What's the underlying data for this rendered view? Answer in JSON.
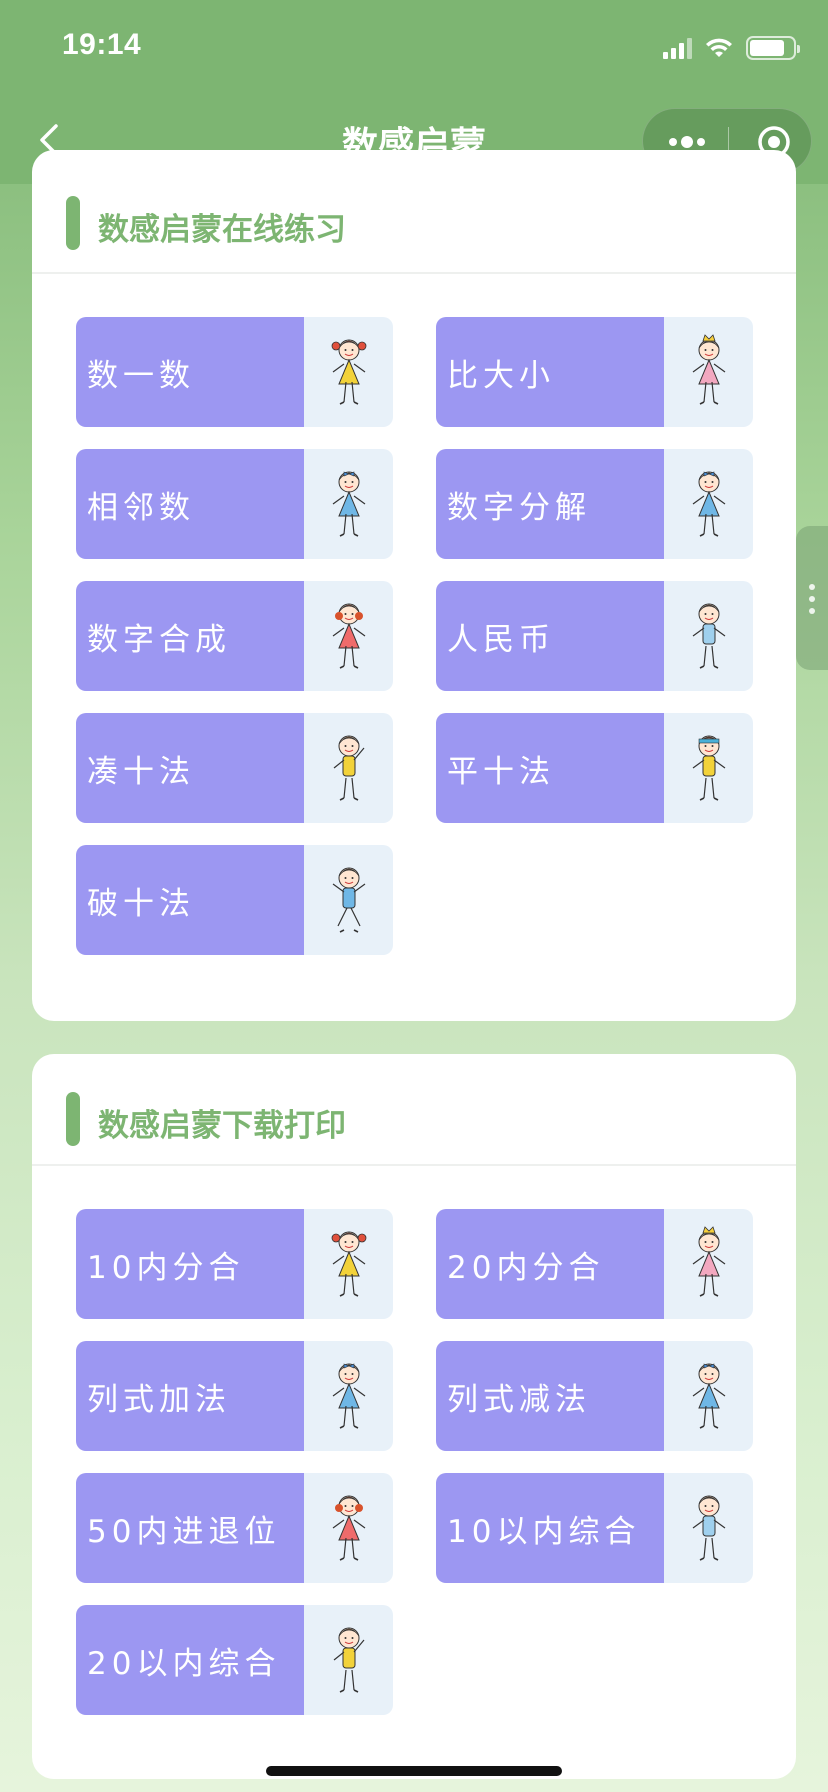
{
  "status_bar": {
    "time": "19:14"
  },
  "nav": {
    "title": "数感启蒙"
  },
  "sections": [
    {
      "title": "数感启蒙在线练习",
      "items": [
        {
          "label": "数一数",
          "kid": "girl-yellow-pigtails"
        },
        {
          "label": "比大小",
          "kid": "princess-pink"
        },
        {
          "label": "相邻数",
          "kid": "girl-blue-dress"
        },
        {
          "label": "数字分解",
          "kid": "girl-blue-dress"
        },
        {
          "label": "数字合成",
          "kid": "girl-red-dress"
        },
        {
          "label": "人民币",
          "kid": "boy-blue"
        },
        {
          "label": "凑十法",
          "kid": "boy-yellow-waving"
        },
        {
          "label": "平十法",
          "kid": "kid-headband"
        },
        {
          "label": "破十法",
          "kid": "boy-blue-jumping"
        }
      ]
    },
    {
      "title": "数感启蒙下载打印",
      "items": [
        {
          "label": "10内分合",
          "kid": "girl-yellow-pigtails"
        },
        {
          "label": "20内分合",
          "kid": "princess-pink"
        },
        {
          "label": "列式加法",
          "kid": "girl-blue-dress"
        },
        {
          "label": "列式减法",
          "kid": "girl-blue-dress"
        },
        {
          "label": "50内进退位",
          "kid": "girl-red-dress"
        },
        {
          "label": "10以内综合",
          "kid": "boy-blue"
        },
        {
          "label": "20以内综合",
          "kid": "boy-yellow-waving"
        }
      ]
    }
  ],
  "colors": {
    "theme_green": "#7db572",
    "tile_purple": "#9c97f2",
    "tile_pic_bg": "#e8f1f9"
  }
}
